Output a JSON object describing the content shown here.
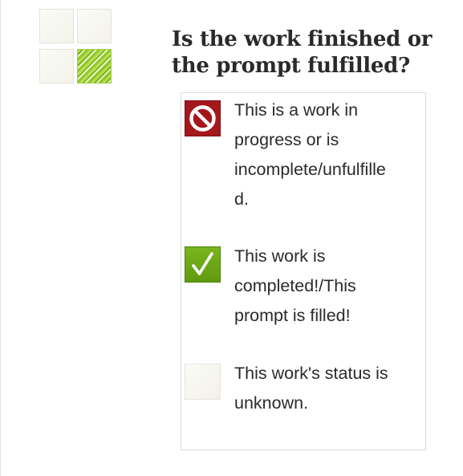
{
  "symbol_grid": {
    "cells": [
      "blank",
      "blank",
      "blank",
      "green-striped"
    ],
    "accent_color": "#8fc52a"
  },
  "heading": {
    "line1": "Is the work finished or",
    "line2": "the prompt fulfilled?"
  },
  "legend": {
    "items": [
      {
        "icon": "prohibited-circle-icon",
        "color": "#a4171b",
        "lines": [
          "This is a work in",
          "progress or is",
          "incomplete/unfulfille",
          "d."
        ]
      },
      {
        "icon": "checkmark-icon",
        "color": "#6aa816",
        "lines": [
          "This work is",
          "completed!/This",
          "prompt is filled!"
        ]
      },
      {
        "icon": "blank-square-icon",
        "color": "#f6f5ee",
        "lines": [
          "This work's status is",
          "unknown."
        ]
      }
    ]
  }
}
